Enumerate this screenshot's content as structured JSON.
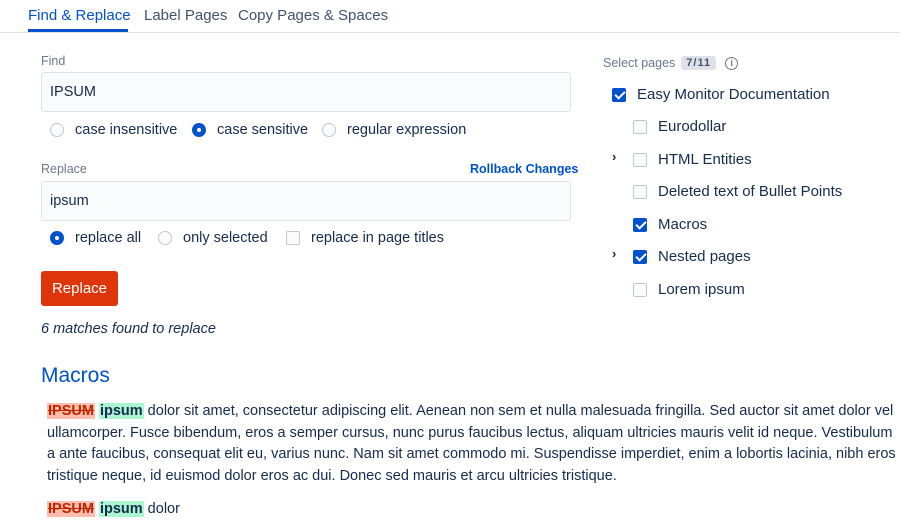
{
  "tabs": [
    {
      "label": "Find & Replace",
      "active": true
    },
    {
      "label": "Label Pages",
      "active": false
    },
    {
      "label": "Copy Pages & Spaces",
      "active": false
    }
  ],
  "find": {
    "label": "Find",
    "value": "IPSUM",
    "options": [
      {
        "label": "case insensitive",
        "selected": false
      },
      {
        "label": "case sensitive",
        "selected": true
      },
      {
        "label": "regular expression",
        "selected": false
      }
    ]
  },
  "replace": {
    "label": "Replace",
    "rollback_label": "Rollback Changes",
    "value": "ipsum",
    "options": [
      {
        "label": "replace all",
        "selected": true
      },
      {
        "label": "only selected",
        "selected": false
      }
    ],
    "titles_checkbox": {
      "label": "replace in page titles",
      "checked": false
    },
    "button_label": "Replace"
  },
  "matches_text": "6 matches found to replace",
  "pages": {
    "title": "Select pages",
    "count": "7/11",
    "info_icon": "info-icon",
    "root": {
      "label": "Easy Monitor Documentation",
      "checked": true
    },
    "children": [
      {
        "label": "Eurodollar",
        "checked": false,
        "expandable": false
      },
      {
        "label": "HTML Entities",
        "checked": false,
        "expandable": true
      },
      {
        "label": "Deleted text of Bullet Points",
        "checked": false,
        "expandable": false
      },
      {
        "label": "Macros",
        "checked": true,
        "expandable": false
      },
      {
        "label": "Nested pages",
        "checked": true,
        "expandable": true
      },
      {
        "label": "Lorem ipsum",
        "checked": false,
        "expandable": false
      }
    ]
  },
  "preview": {
    "section_title": "Macros",
    "p1": {
      "del": "IPSUM",
      "ins": "ipsum",
      "text": " dolor sit amet, consectetur adipiscing elit. Aenean non sem et nulla malesuada fringilla. Sed auctor sit amet dolor vel ullamcorper. Fusce bibendum, eros a semper cursus, nunc purus faucibus lectus, aliquam ultricies mauris velit id neque. Vestibulum a ante faucibus, consequat elit eu, varius nunc. Nam sit amet commodo mi. Suspendisse imperdiet, enim a lobortis lacinia, nibh eros tristique neque, id euismod dolor eros ac dui. Donec sed mauris et arcu ultricies tristique."
    },
    "p2": {
      "del": "IPSUM",
      "ins": "ipsum",
      "text": " dolor"
    }
  },
  "colors": {
    "accent": "#0052cc",
    "replace_button": "#de350b",
    "deleted_bg": "#ffbdad",
    "inserted_bg": "#abf5d1"
  }
}
